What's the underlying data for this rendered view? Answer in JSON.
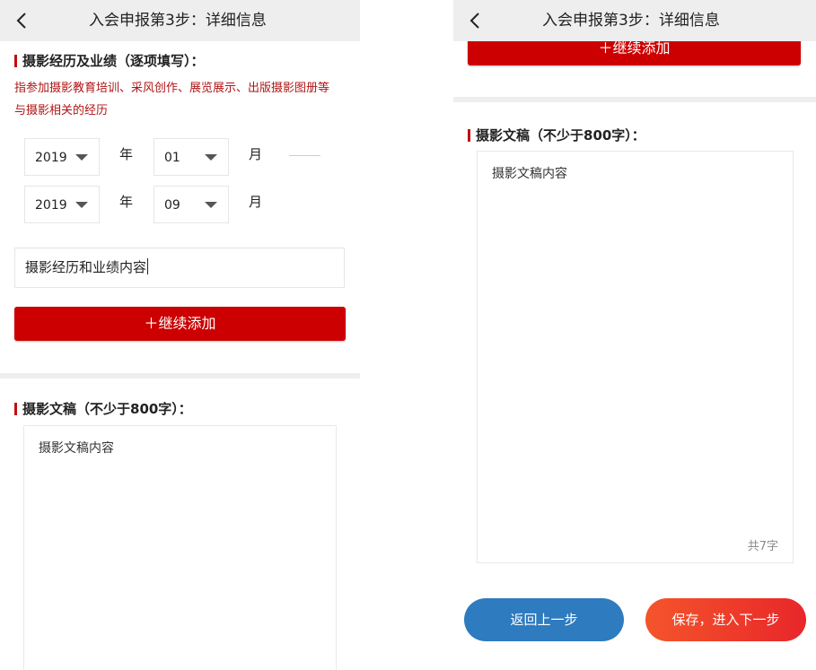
{
  "header": {
    "title": "入会申报第3步：详细信息"
  },
  "experience": {
    "title": "摄影经历及业绩（逐项填写）：",
    "hint_line1": "指参加摄影教育培训、采风创作、展览展示、出版摄影图册等",
    "hint_line2": "与摄影相关的经历",
    "start_year": "2019",
    "start_month": "01",
    "end_year": "2019",
    "end_month": "09",
    "year_unit": "年",
    "month_unit": "月",
    "content_value": "摄影经历和业绩内容",
    "add_label": "＋继续添加"
  },
  "essay": {
    "title": "摄影文稿（不少于800字）：",
    "content": "摄影文稿内容",
    "counter": "共7字"
  },
  "footer": {
    "back_label": "返回上一步",
    "next_label": "保存，进入下一步"
  },
  "colors": {
    "accent_red": "#cc0000",
    "hint_red": "#b01515",
    "blue_button": "#2e7bbf",
    "header_bg": "#eeeeee"
  }
}
